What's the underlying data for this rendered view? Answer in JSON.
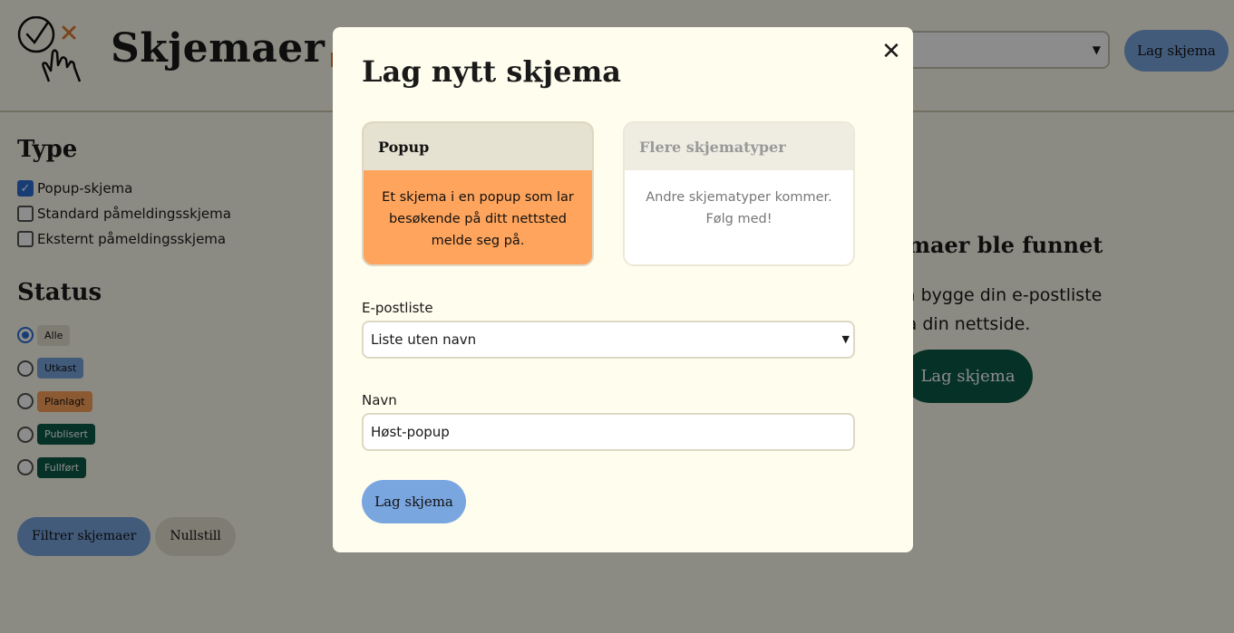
{
  "header": {
    "title": "Skjemaer",
    "create_button": "Lag skjema"
  },
  "sidebar": {
    "type_heading": "Type",
    "types": [
      {
        "label": "Popup-skjema",
        "checked": true
      },
      {
        "label": "Standard påmeldingsskjema",
        "checked": false
      },
      {
        "label": "Eksternt påmeldingsskjema",
        "checked": false
      }
    ],
    "status_heading": "Status",
    "statuses": [
      {
        "label": "Alle",
        "selected": true
      },
      {
        "label": "Utkast",
        "selected": false
      },
      {
        "label": "Planlagt",
        "selected": false
      },
      {
        "label": "Publisert",
        "selected": false
      },
      {
        "label": "Fullført",
        "selected": false
      }
    ],
    "filter_button": "Filtrer skjemaer",
    "reset_button": "Nullstill"
  },
  "empty_state": {
    "title": "kjemaer ble funnet",
    "text_line1": "r til å bygge din e-postliste",
    "text_line2": "te fra din nettside.",
    "button": "Lag skjema"
  },
  "modal": {
    "title": "Lag nytt skjema",
    "close_glyph": "✕",
    "cards": [
      {
        "title": "Popup",
        "description": "Et skjema i en popup som lar besøkende på ditt nettsted melde seg på.",
        "selected": true
      },
      {
        "title": "Flere skjematyper",
        "description": "Andre skjematyper kommer. Følg med!",
        "selected": false
      }
    ],
    "list_label": "E-postliste",
    "list_value": "Liste uten navn",
    "name_label": "Navn",
    "name_value": "Høst-popup",
    "submit_button": "Lag skjema"
  },
  "colors": {
    "background": "#fffdee",
    "primary": "#7aa6e0",
    "accent_orange": "#ffa45c",
    "dark_green": "#0c5a45"
  }
}
